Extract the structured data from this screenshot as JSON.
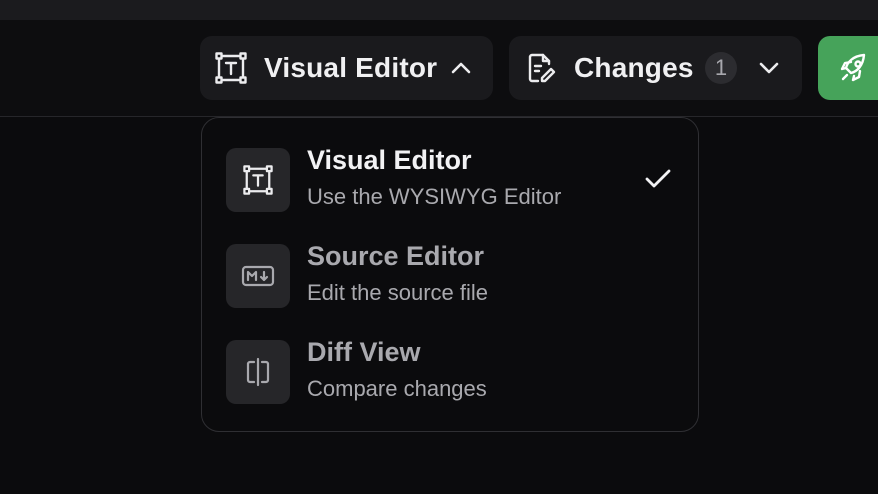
{
  "toolbar": {
    "editor_button": {
      "label": "Visual Editor",
      "icon": "text-frame-icon",
      "state": "open"
    },
    "changes_button": {
      "label": "Changes",
      "count": "1",
      "icon": "document-edit-icon"
    },
    "publish_button": {
      "icon": "rocket-icon",
      "color": "#46a35a"
    }
  },
  "menu": {
    "items": [
      {
        "title": "Visual Editor",
        "description": "Use the WYSIWYG Editor",
        "icon": "text-frame-icon",
        "selected": true
      },
      {
        "title": "Source Editor",
        "description": "Edit the source file",
        "icon": "markdown-icon",
        "selected": false
      },
      {
        "title": "Diff View",
        "description": "Compare changes",
        "icon": "split-view-icon",
        "selected": false
      }
    ]
  },
  "colors": {
    "background": "#0b0b0d",
    "accent_green": "#46a35a",
    "muted_text": "#a9a9ae"
  }
}
